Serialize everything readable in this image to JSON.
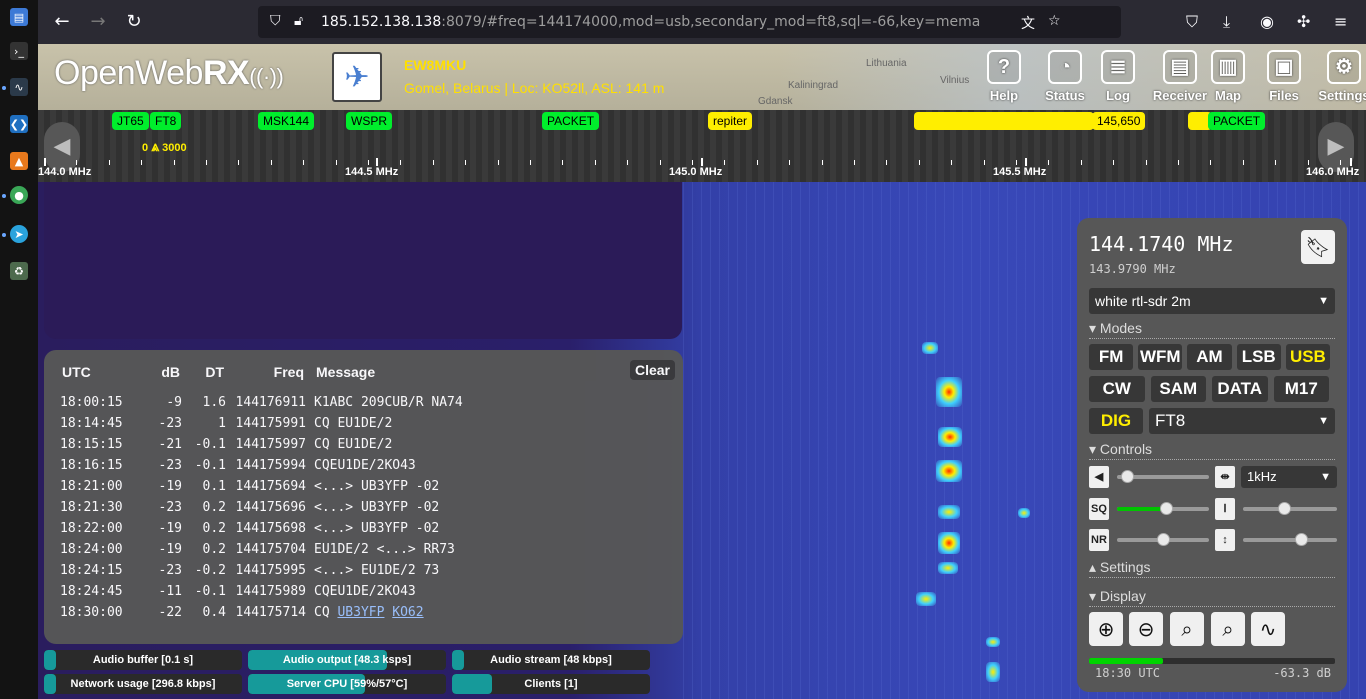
{
  "browser": {
    "url_host": "185.152.138.138",
    "url_rest": ":8079/#freq=144174000,mod=usb,secondary_mod=ft8,sql=-66,key=mema"
  },
  "header": {
    "logo_light": "OpenWeb",
    "logo_bold": "RX",
    "callsign": "EW8MKU",
    "location": "Gomel, Belarus | Loc: KO52ll, ASL: 141 m",
    "map_labels": [
      "Lithuania",
      "Vilnius",
      "Kaliningrad",
      "Gdansk"
    ],
    "buttons": [
      {
        "label": "Help",
        "icon": "help-icon",
        "glyph": "?"
      },
      {
        "label": "Status",
        "icon": "gauge-icon",
        "glyph": "◔"
      },
      {
        "label": "Log",
        "icon": "log-icon",
        "glyph": "≣"
      },
      {
        "label": "Receiver",
        "icon": "radio-icon",
        "glyph": "▤"
      },
      {
        "label": "Map",
        "icon": "map-icon",
        "glyph": "▥"
      },
      {
        "label": "Files",
        "icon": "image-icon",
        "glyph": "▣"
      },
      {
        "label": "Settings",
        "icon": "gear-icon",
        "glyph": "⚙"
      }
    ]
  },
  "scale": {
    "bookmarks": [
      {
        "label": "JT65",
        "color": "g"
      },
      {
        "label": "FT8",
        "color": "g"
      },
      {
        "label": "MSK144",
        "color": "g"
      },
      {
        "label": "WSPR",
        "color": "g"
      },
      {
        "label": "PACKET",
        "color": "g"
      },
      {
        "label": "repiter",
        "color": "y"
      },
      {
        "label": "145,650",
        "color": "y"
      },
      {
        "label": "PACKET",
        "color": "g"
      }
    ],
    "passband_low": "0",
    "passband_high": "3000",
    "freq_labels": [
      "144.0 MHz",
      "144.5 MHz",
      "145.0 MHz",
      "145.5 MHz",
      "146.0 MHz"
    ]
  },
  "messages": {
    "clear_label": "Clear",
    "columns": [
      "UTC",
      "dB",
      "DT",
      "Freq",
      "Message"
    ],
    "rows": [
      {
        "utc": "18:00:15",
        "db": "-9",
        "dt": "1.6",
        "freq": "144176911",
        "msg": "K1ABC 209CUB/R NA74"
      },
      {
        "utc": "18:14:45",
        "db": "-23",
        "dt": "1",
        "freq": "144175991",
        "msg": "CQ EU1DE/2"
      },
      {
        "utc": "18:15:15",
        "db": "-21",
        "dt": "-0.1",
        "freq": "144175997",
        "msg": "CQ EU1DE/2"
      },
      {
        "utc": "18:16:15",
        "db": "-23",
        "dt": "-0.1",
        "freq": "144175994",
        "msg": "CQEU1DE/2KO43"
      },
      {
        "utc": "18:21:00",
        "db": "-19",
        "dt": "0.1",
        "freq": "144175694",
        "msg": "<...> UB3YFP -02"
      },
      {
        "utc": "18:21:30",
        "db": "-23",
        "dt": "0.2",
        "freq": "144175696",
        "msg": "<...> UB3YFP -02"
      },
      {
        "utc": "18:22:00",
        "db": "-19",
        "dt": "0.2",
        "freq": "144175698",
        "msg": "<...> UB3YFP -02"
      },
      {
        "utc": "18:24:00",
        "db": "-19",
        "dt": "0.2",
        "freq": "144175704",
        "msg": "EU1DE/2 <...> RR73"
      },
      {
        "utc": "18:24:15",
        "db": "-23",
        "dt": "-0.2",
        "freq": "144175995",
        "msg": "<...> EU1DE/2 73"
      },
      {
        "utc": "18:24:45",
        "db": "-11",
        "dt": "-0.1",
        "freq": "144175989",
        "msg": "CQEU1DE/2KO43"
      },
      {
        "utc": "18:30:00",
        "db": "-22",
        "dt": "0.4",
        "freq": "144175714",
        "msg": "CQ ",
        "link1": "UB3YFP",
        "link2": "KO62"
      }
    ]
  },
  "status_bars": [
    {
      "label": "Audio buffer [0.1 s]",
      "fill": 0.06
    },
    {
      "label": "Audio output [48.3 ksps]",
      "fill": 0.7
    },
    {
      "label": "Audio stream [48 kbps]",
      "fill": 0.04
    },
    {
      "label": "Network usage [296.8 kbps]",
      "fill": 0.06
    },
    {
      "label": "Server CPU [59%/57°C]",
      "fill": 0.59
    },
    {
      "label": "Clients [1]",
      "fill": 0.2
    }
  ],
  "receiver": {
    "frequency": "144.1740 MHz",
    "center_frequency": "143.9790 MHz",
    "profile": "white rtl-sdr 2m",
    "modes_title": "Modes",
    "modes_row1": [
      "FM",
      "WFM",
      "AM",
      "LSB",
      "USB"
    ],
    "modes_row2": [
      "CW",
      "SAM",
      "DATA",
      "M17"
    ],
    "active_mode": "USB",
    "dig_label": "DIG",
    "digital_mode": "FT8",
    "controls_title": "Controls",
    "bandwidth": "1kHz",
    "sq_label": "SQ",
    "nr_label": "NR",
    "squelch_level": 0.55,
    "volume_level": 0.05,
    "nr_level": 0.5,
    "settings_title": "Settings",
    "display_title": "Display",
    "smeter_level": 0.3,
    "time": "18:30 UTC",
    "db": "-63.3 dB"
  }
}
